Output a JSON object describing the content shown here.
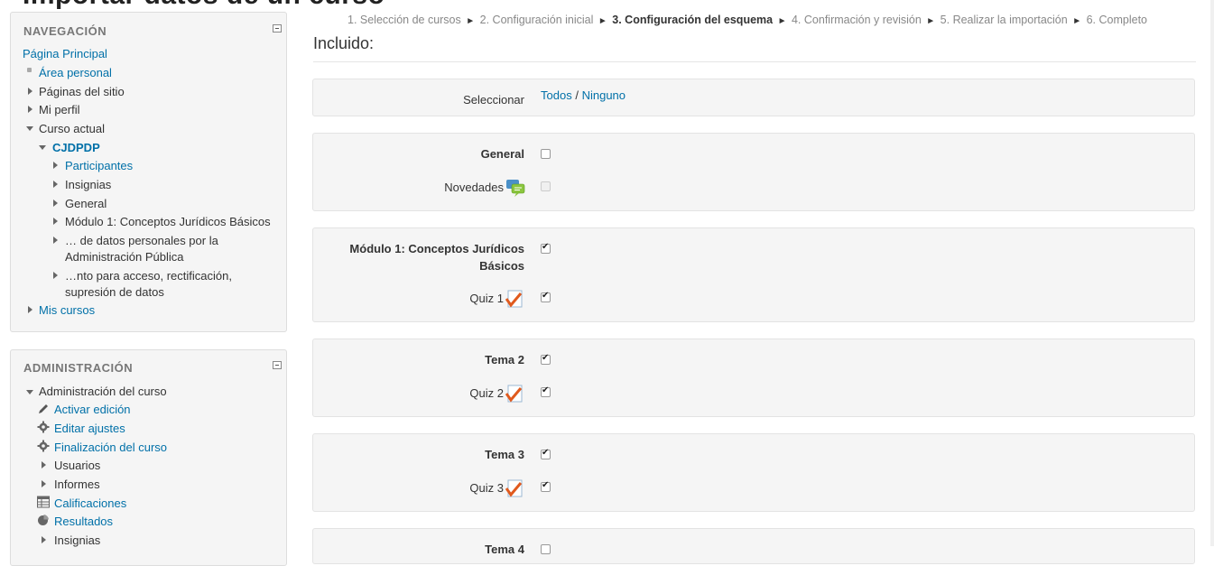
{
  "page": {
    "heading": "Importar datos de un curso"
  },
  "breadcrumb": {
    "steps": [
      "1. Selección de cursos",
      "2. Configuración inicial",
      "3. Configuración del esquema",
      "4. Confirmación y revisión",
      "5. Realizar la importación",
      "6. Completo"
    ],
    "separator": "►"
  },
  "nav": {
    "title": "NAVEGACIÓN",
    "home": "Página Principal",
    "items": [
      "Área personal",
      "Páginas del sitio",
      "Mi perfil",
      "Curso actual",
      "CJDPDP",
      "Participantes",
      "Insignias",
      "General",
      "Módulo 1: Conceptos Jurídicos Básicos",
      "… de datos personales por la",
      "Administración Pública",
      "…nto para acceso, rectificación,",
      "supresión de datos",
      "Mis cursos"
    ]
  },
  "admin": {
    "title": "ADMINISTRACIÓN",
    "items": [
      "Administración del curso",
      "Activar edición",
      "Editar ajustes",
      "Finalización del curso",
      "Usuarios",
      "Informes",
      "Calificaciones",
      "Resultados",
      "Insignias"
    ]
  },
  "main": {
    "included_title": "Incluido:",
    "select": {
      "label": "Seleccionar",
      "all": "Todos",
      "slash": "/",
      "none": "Ninguno"
    },
    "sections": [
      {
        "title": "General",
        "checked": false,
        "activity": "Novedades",
        "activity_checked": false,
        "activity_type": "forum"
      },
      {
        "title": "Módulo 1: Conceptos Jurídicos",
        "title2": "Básicos",
        "checked": true,
        "activity": "Quiz 1",
        "activity_checked": true,
        "activity_type": "quiz"
      },
      {
        "title": "Tema 2",
        "checked": true,
        "activity": "Quiz 2",
        "activity_checked": true,
        "activity_type": "quiz"
      },
      {
        "title": "Tema 3",
        "checked": true,
        "activity": "Quiz 3",
        "activity_checked": true,
        "activity_type": "quiz"
      },
      {
        "title": "Tema 4",
        "checked": false
      }
    ]
  },
  "colors": {
    "link": "#0070a8",
    "well": "#f5f5f5",
    "border": "#e3e3e3"
  }
}
